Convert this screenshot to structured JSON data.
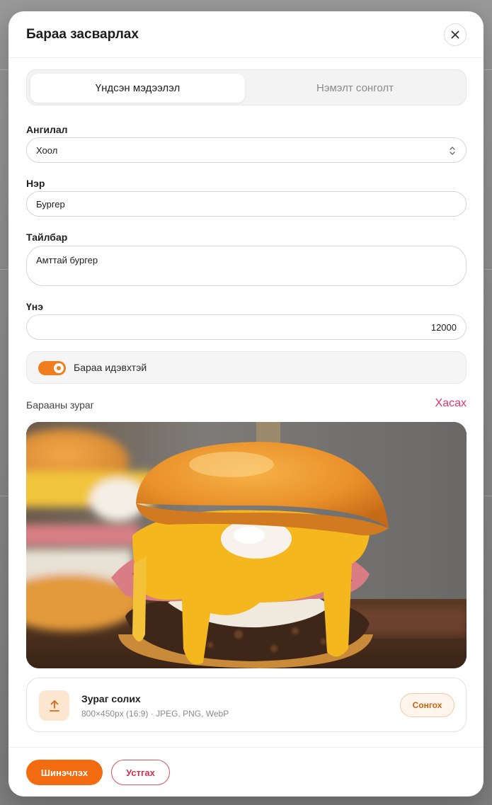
{
  "modal": {
    "title": "Бараа засварлах"
  },
  "tabs": [
    {
      "label": "Үндсэн мэдээлэл",
      "active": true
    },
    {
      "label": "Нэмэлт сонголт",
      "active": false
    }
  ],
  "form": {
    "category": {
      "label": "Ангилал",
      "value": "Хоол"
    },
    "name": {
      "label": "Нэр",
      "value": "Бургер"
    },
    "description": {
      "label": "Тайлбар",
      "value": "Амттай бургер"
    },
    "price": {
      "label": "Үнэ",
      "value": "12000"
    },
    "active_toggle": {
      "label": "Бараа идэвхтэй",
      "checked": true
    }
  },
  "image_section": {
    "label": "Барааны зураг",
    "remove_label": "Хасах",
    "preview_alt": "burger-photo"
  },
  "upload": {
    "title": "Зураг солих",
    "hint": "800×450px (16:9) · JPEG, PNG, WebP",
    "choose_label": "Сонгох"
  },
  "footer": {
    "save_label": "Шинэчлэх",
    "cancel_label": "Устгах"
  },
  "colors": {
    "accent": "#f26b10",
    "danger": "#d9304a",
    "link": "#e0356e"
  }
}
